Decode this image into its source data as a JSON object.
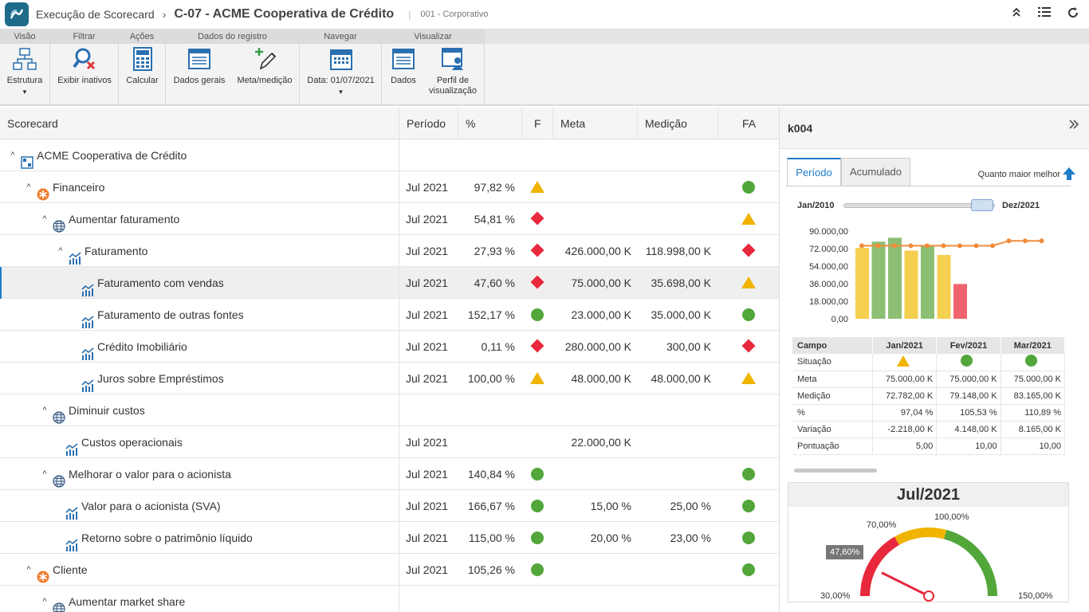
{
  "header": {
    "breadcrumb1": "Execução de Scorecard",
    "title": "C-07 - ACME Cooperativa de Crédito",
    "subtitle": "001 - Corporativo",
    "icons": [
      "collapse-up-icon",
      "list-icon",
      "refresh-icon"
    ]
  },
  "ribbon": {
    "groups": [
      "Visão",
      "Filtrar",
      "Ações",
      "Dados do registro",
      "Navegar",
      "Visualizar"
    ],
    "estrutura": "Estrutura",
    "exibir_inativos": "Exibir inativos",
    "calcular": "Calcular",
    "dados_gerais": "Dados gerais",
    "meta_medicao": "Meta/medição",
    "data": "Data: 01/07/2021",
    "dados": "Dados",
    "perfil1": "Perfil de",
    "perfil2": "visualização"
  },
  "table": {
    "columns": [
      "Scorecard",
      "Período",
      "%",
      "F",
      "Meta",
      "Medição",
      "FA"
    ],
    "rows": [
      {
        "name": "ACME Cooperativa de Crédito",
        "periodo": "",
        "pct": "",
        "f": "",
        "meta": "",
        "medicao": "",
        "fa": ""
      },
      {
        "name": "Financeiro",
        "periodo": "Jul 2021",
        "pct": "97,82 %",
        "f": "triangle",
        "meta": "",
        "medicao": "",
        "fa": "circle"
      },
      {
        "name": "Aumentar faturamento",
        "periodo": "Jul 2021",
        "pct": "54,81 %",
        "f": "diamond",
        "meta": "",
        "medicao": "",
        "fa": "triangle"
      },
      {
        "name": "Faturamento",
        "periodo": "Jul 2021",
        "pct": "27,93 %",
        "f": "diamond",
        "meta": "426.000,00 K",
        "medicao": "118.998,00 K",
        "fa": "diamond"
      },
      {
        "name": "Faturamento com vendas",
        "periodo": "Jul 2021",
        "pct": "47,60 %",
        "f": "diamond",
        "meta": "75.000,00 K",
        "medicao": "35.698,00 K",
        "fa": "triangle"
      },
      {
        "name": "Faturamento de outras fontes",
        "periodo": "Jul 2021",
        "pct": "152,17 %",
        "f": "circle",
        "meta": "23.000,00 K",
        "medicao": "35.000,00 K",
        "fa": "circle"
      },
      {
        "name": "Crédito Imobiliário",
        "periodo": "Jul 2021",
        "pct": "0,11 %",
        "f": "diamond",
        "meta": "280.000,00 K",
        "medicao": "300,00 K",
        "fa": "diamond"
      },
      {
        "name": "Juros sobre Empréstimos",
        "periodo": "Jul 2021",
        "pct": "100,00 %",
        "f": "triangle",
        "meta": "48.000,00 K",
        "medicao": "48.000,00 K",
        "fa": "triangle"
      },
      {
        "name": "Diminuir custos",
        "periodo": "",
        "pct": "",
        "f": "",
        "meta": "",
        "medicao": "",
        "fa": ""
      },
      {
        "name": "Custos operacionais",
        "periodo": "Jul 2021",
        "pct": "",
        "f": "",
        "meta": "22.000,00 K",
        "medicao": "",
        "fa": ""
      },
      {
        "name": "Melhorar o valor para o acionista",
        "periodo": "Jul 2021",
        "pct": "140,84 %",
        "f": "circle",
        "meta": "",
        "medicao": "",
        "fa": "circle"
      },
      {
        "name": "Valor para o acionista (SVA)",
        "periodo": "Jul 2021",
        "pct": "166,67 %",
        "f": "circle",
        "meta": "15,00 %",
        "medicao": "25,00 %",
        "fa": "circle"
      },
      {
        "name": "Retorno sobre o patrimônio líquido",
        "periodo": "Jul 2021",
        "pct": "115,00 %",
        "f": "circle",
        "meta": "20,00 %",
        "medicao": "23,00 %",
        "fa": "circle"
      },
      {
        "name": "Cliente",
        "periodo": "Jul 2021",
        "pct": "105,26 %",
        "f": "circle",
        "meta": "",
        "medicao": "",
        "fa": "circle"
      },
      {
        "name": "Aumentar market share",
        "periodo": "",
        "pct": "",
        "f": "",
        "meta": "",
        "medicao": "",
        "fa": ""
      }
    ]
  },
  "panel": {
    "title": "k004",
    "tab_periodo": "Período",
    "tab_acumulado": "Acumulado",
    "better": "Quanto maior melhor",
    "slider_start": "Jan/2010",
    "slider_end": "Dez/2021",
    "table_headers": [
      "Campo",
      "Jan/2021",
      "Fev/2021",
      "Mar/2021"
    ],
    "table_rows": [
      {
        "campo": "Situação",
        "v": [
          "triangle",
          "circle",
          "circle"
        ]
      },
      {
        "campo": "Meta",
        "v": [
          "75.000,00 K",
          "75.000,00 K",
          "75.000,00 K"
        ]
      },
      {
        "campo": "Medição",
        "v": [
          "72.782,00 K",
          "79.148,00 K",
          "83.165,00 K"
        ]
      },
      {
        "campo": "%",
        "v": [
          "97,04 %",
          "105,53 %",
          "110,89 %"
        ]
      },
      {
        "campo": "Variação",
        "v": [
          "-2.218,00 K",
          "4.148,00 K",
          "8.165,00 K"
        ]
      },
      {
        "campo": "Pontuação",
        "v": [
          "5,00",
          "10,00",
          "10,00"
        ]
      }
    ],
    "gauge": {
      "title": "Jul/2021",
      "value_label": "47,60%",
      "value": 47.6,
      "min_label": "30,00%",
      "mark1_label": "70,00%",
      "mark2_label": "100,00%",
      "max_label": "150,00%",
      "min": 30,
      "max": 150
    }
  },
  "colors": {
    "green": "#52a63a",
    "yellow": "#f0b400",
    "red": "#e8283c",
    "accent": "#1e7bc8",
    "bar_yellow": "#f5cf4f",
    "bar_green": "#8cbf74",
    "bar_red": "#f06470",
    "line": "#f08c3c"
  },
  "chart_data": {
    "type": "bar",
    "ylim": [
      0,
      90000
    ],
    "yticks": [
      "90.000,00",
      "72.000,00",
      "54.000,00",
      "36.000,00",
      "18.000,00",
      "0,00"
    ],
    "bars": [
      72782,
      79148,
      83165,
      70000,
      75500,
      65500,
      35698
    ],
    "bar_status": [
      "yellow",
      "green",
      "green",
      "yellow",
      "green",
      "yellow",
      "red"
    ],
    "meta_line": [
      75000,
      75000,
      75000,
      75000,
      75000,
      75000,
      75000,
      75000,
      75000,
      80000,
      80000,
      80000
    ]
  }
}
